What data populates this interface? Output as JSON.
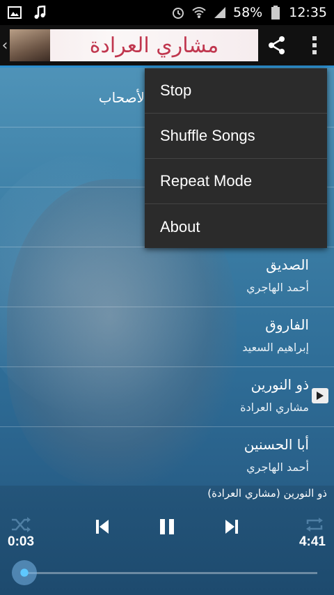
{
  "status_bar": {
    "battery_percent": "58%",
    "time": "12:35",
    "icons": [
      "image-icon",
      "music-note-icon",
      "alarm-icon",
      "wifi-icon",
      "signal-icon",
      "battery-icon"
    ]
  },
  "action_bar": {
    "banner_title": "مشاري العرادة",
    "icons": [
      "back-chevron-icon",
      "share-icon",
      "overflow-menu-icon"
    ]
  },
  "songs": [
    {
      "title": "لأصحاب",
      "artist": "",
      "playing": false
    },
    {
      "title": "",
      "artist": "",
      "playing": false
    },
    {
      "title": "",
      "artist": "",
      "playing": false
    },
    {
      "title": "الصديق",
      "artist": "أحمد الهاجري",
      "playing": false
    },
    {
      "title": "الفاروق",
      "artist": "إبراهيم السعيد",
      "playing": false
    },
    {
      "title": "ذو النورين",
      "artist": "مشاري العرادة",
      "playing": true
    },
    {
      "title": "أبا الحسنين",
      "artist": "أحمد الهاجري",
      "playing": false
    }
  ],
  "menu": {
    "items": [
      "Stop",
      "Shuffle Songs",
      "Repeat Mode",
      "About"
    ]
  },
  "player": {
    "now_playing": "ذو النورين (مشاري العرادة)",
    "elapsed": "0:03",
    "duration": "4:41",
    "progress_fraction": 0.011,
    "icons": [
      "shuffle-icon",
      "previous-icon",
      "pause-icon",
      "next-icon",
      "repeat-icon"
    ],
    "accent_color": "#5ec8ff"
  }
}
